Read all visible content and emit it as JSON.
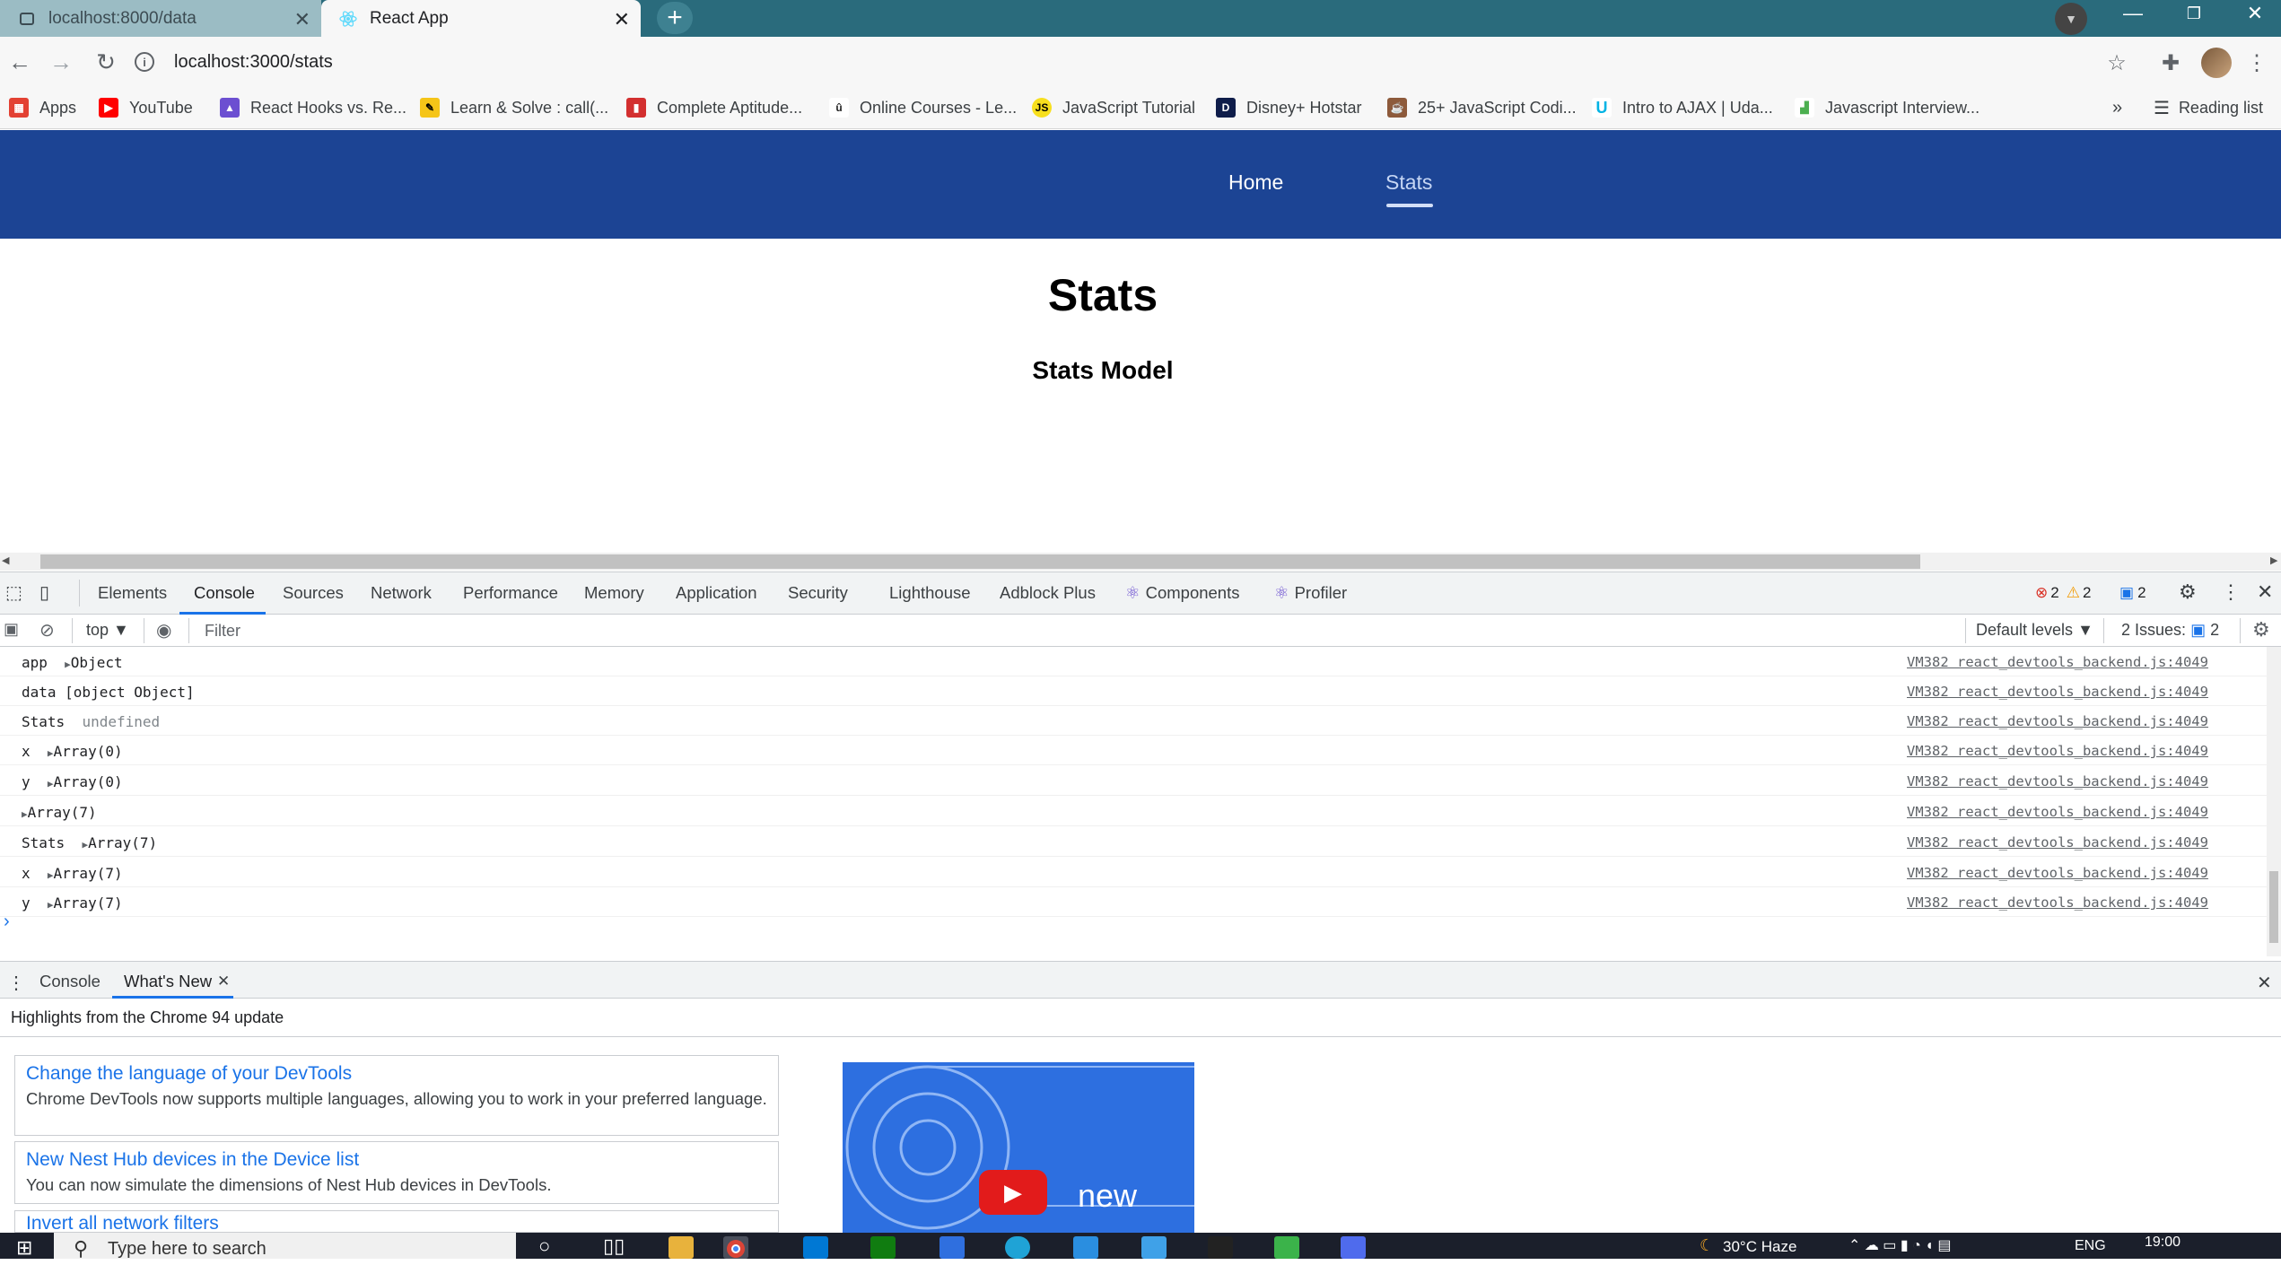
{
  "browser": {
    "tabs": [
      {
        "title": "localhost:8000/data",
        "active": false
      },
      {
        "title": "React App",
        "active": true
      }
    ],
    "url": "localhost:3000/stats",
    "bookmarks": [
      "Apps",
      "YouTube",
      "React Hooks vs. Re...",
      "Learn & Solve : call(...",
      "Complete Aptitude...",
      "Online Courses - Le...",
      "JavaScript Tutorial",
      "Disney+ Hotstar",
      "25+ JavaScript Codi...",
      "Intro to AJAX | Uda...",
      "Javascript Interview..."
    ],
    "overflow_label": "»",
    "reading_list": "Reading list"
  },
  "app": {
    "nav": {
      "home": "Home",
      "stats": "Stats"
    },
    "title": "Stats",
    "subtitle": "Stats Model"
  },
  "devtools": {
    "tabs": [
      "Elements",
      "Console",
      "Sources",
      "Network",
      "Performance",
      "Memory",
      "Application",
      "Security",
      "Lighthouse",
      "Adblock Plus",
      "Components",
      "Profiler"
    ],
    "errors": "2",
    "warnings": "2",
    "messages": "2",
    "context": "top",
    "filter_placeholder": "Filter",
    "levels": "Default levels",
    "issues_label": "2 Issues:",
    "issues_count": "2",
    "logs": [
      {
        "label": "app",
        "value": "Object",
        "expandable": true,
        "source": "VM382 react_devtools_backend.js:4049"
      },
      {
        "label": "data [object Object]",
        "value": "",
        "expandable": false,
        "source": "VM382 react_devtools_backend.js:4049"
      },
      {
        "label": "Stats",
        "value": "undefined",
        "expandable": false,
        "muted": true,
        "source": "VM382 react_devtools_backend.js:4049"
      },
      {
        "label": "x",
        "value": "Array(0)",
        "expandable": true,
        "source": "VM382 react_devtools_backend.js:4049"
      },
      {
        "label": "y",
        "value": "Array(0)",
        "expandable": true,
        "source": "VM382 react_devtools_backend.js:4049"
      },
      {
        "label": "",
        "value": "Array(7)",
        "expandable": true,
        "source": "VM382 react_devtools_backend.js:4049"
      },
      {
        "label": "Stats",
        "value": "Array(7)",
        "expandable": true,
        "source": "VM382 react_devtools_backend.js:4049"
      },
      {
        "label": "x",
        "value": "Array(7)",
        "expandable": true,
        "source": "VM382 react_devtools_backend.js:4049"
      },
      {
        "label": "y",
        "value": "Array(7)",
        "expandable": true,
        "source": "VM382 react_devtools_backend.js:4049"
      }
    ],
    "drawer": {
      "tabs": [
        "Console",
        "What's New"
      ],
      "highlights": "Highlights from the Chrome 94 update",
      "cards": [
        {
          "title": "Change the language of your DevTools",
          "desc": "Chrome DevTools now supports multiple languages, allowing you to work in your preferred language."
        },
        {
          "title": "New Nest Hub devices in the Device list",
          "desc": "You can now simulate the dimensions of Nest Hub devices in DevTools."
        },
        {
          "title": "Invert all network filters",
          "desc": ""
        }
      ],
      "video_label": "new"
    }
  },
  "taskbar": {
    "search_placeholder": "Type here to search",
    "weather": "30°C  Haze",
    "lang": "ENG",
    "time": "19:00"
  },
  "colors": {
    "app_nav": "#1c4494",
    "tab_strip": "#2a6b7c",
    "link": "#1a73e8"
  }
}
